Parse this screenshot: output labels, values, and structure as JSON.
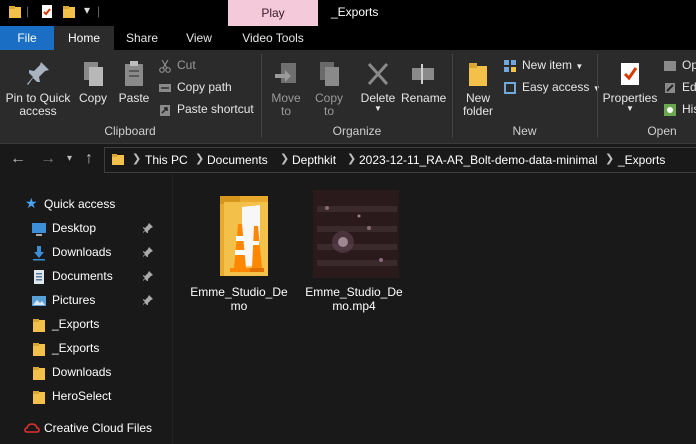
{
  "titlebar": {
    "contextual_tab": "Play",
    "window_title": "_Exports"
  },
  "tabs": {
    "file": "File",
    "home": "Home",
    "share": "Share",
    "view": "View",
    "video_tools": "Video Tools"
  },
  "ribbon": {
    "clipboard": {
      "pin_line1": "Pin to Quick",
      "pin_line2": "access",
      "copy": "Copy",
      "paste": "Paste",
      "cut": "Cut",
      "copy_path": "Copy path",
      "paste_shortcut": "Paste shortcut",
      "label": "Clipboard"
    },
    "organize": {
      "move_line1": "Move",
      "move_line2": "to",
      "copy_line1": "Copy",
      "copy_line2": "to",
      "delete_line1": "Delete",
      "rename": "Rename",
      "label": "Organize"
    },
    "new": {
      "folder_line1": "New",
      "folder_line2": "folder",
      "new_item": "New item",
      "easy_access": "Easy access",
      "label": "New"
    },
    "open": {
      "properties": "Properties",
      "open_partial": "Op",
      "edit_partial": "Edi",
      "history_partial": "His",
      "label": "Open"
    }
  },
  "address": {
    "crumbs": [
      "This PC",
      "Documents",
      "Depthkit",
      "2023-12-11_RA-AR_Bolt-demo-data-minimal",
      "_Exports"
    ]
  },
  "navpane": {
    "quick_access": "Quick access",
    "items": [
      {
        "label": "Desktop",
        "icon": "desktop-icon",
        "pinned": true
      },
      {
        "label": "Downloads",
        "icon": "downloads-icon",
        "pinned": true
      },
      {
        "label": "Documents",
        "icon": "documents-icon",
        "pinned": true
      },
      {
        "label": "Pictures",
        "icon": "pictures-icon",
        "pinned": true
      },
      {
        "label": "_Exports",
        "icon": "folder-icon",
        "pinned": false
      },
      {
        "label": "_Exports",
        "icon": "folder-icon",
        "pinned": false
      },
      {
        "label": "Downloads",
        "icon": "folder-icon",
        "pinned": false
      },
      {
        "label": "HeroSelect",
        "icon": "folder-icon",
        "pinned": false
      }
    ],
    "creative_cloud": "Creative Cloud Files"
  },
  "files": [
    {
      "name": "Emme_Studio_Demo",
      "icon": "vlc-folder-icon"
    },
    {
      "name": "Emme_Studio_Demo.mp4",
      "icon": "video-thumbnail"
    }
  ],
  "colors": {
    "file_tab": "#1a6fc4",
    "play_tab": "#f4c9da",
    "folder": "#f3c04a",
    "background": "#191919"
  }
}
